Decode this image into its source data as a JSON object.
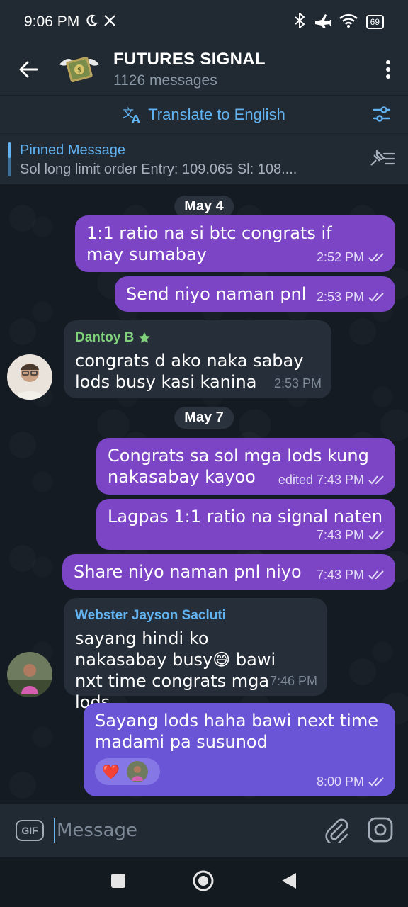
{
  "status_bar": {
    "time": "9:06 PM",
    "battery": "69"
  },
  "header": {
    "title": "FUTURES SIGNAL",
    "subtitle": "1126 messages"
  },
  "translate_bar": {
    "label": "Translate to English"
  },
  "pinned": {
    "title": "Pinned Message",
    "text": "Sol long limit order Entry: 109.065 Sl: 108...."
  },
  "messages": {
    "date1": "May 4",
    "m1": {
      "text": "1:1 ratio na si btc congrats if may sumabay",
      "time": "2:52 PM"
    },
    "m2": {
      "text": "Send niyo naman pnl",
      "time": "2:53 PM"
    },
    "m3": {
      "sender": "Dantoy B",
      "text": "congrats d ako naka sabay lods busy kasi kanina",
      "time": "2:53 PM"
    },
    "date2": "May 7",
    "m4": {
      "text": "Congrats sa sol mga lods kung nakasabay kayoo",
      "time": "edited 7:43 PM"
    },
    "m5": {
      "text": "Lagpas 1:1 ratio na signal naten",
      "time": "7:43 PM"
    },
    "m6": {
      "text": "Share niyo naman pnl niyo",
      "time": "7:43 PM"
    },
    "m7": {
      "sender": "Webster Jayson Sacluti",
      "text": "sayang hindi ko nakasabay busy😅 bawi nxt time congrats mga lods",
      "time": "7:46 PM"
    },
    "m8": {
      "text": "Sayang lods haha bawi next time madami pa susunod",
      "time": "8:00 PM",
      "reaction": "❤️"
    }
  },
  "input": {
    "gif_label": "GIF",
    "placeholder": "Message"
  },
  "colors": {
    "outgoing_bubble": "#7b45c5",
    "incoming_bubble": "#262f39",
    "accent": "#62b3f2",
    "sender1": "#7fd17a",
    "sender2": "#62b3f2"
  }
}
